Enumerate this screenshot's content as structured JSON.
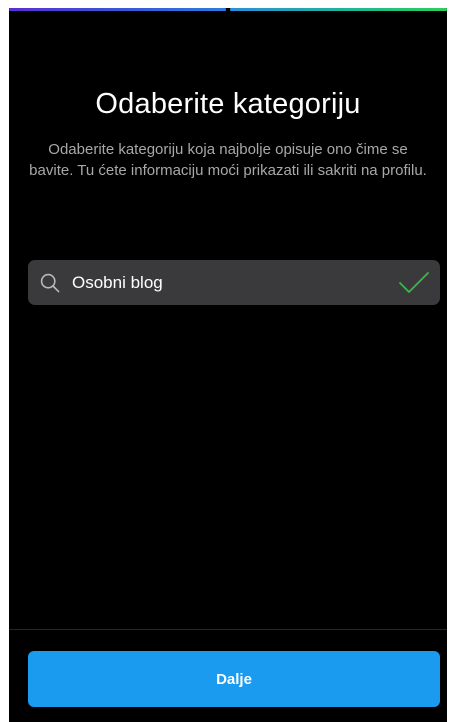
{
  "header": {
    "title": "Odaberite kategoriju",
    "subtitle": "Odaberite kategoriju koja najbolje opisuje ono čime se bavite. Tu ćete informaciju moći prikazati ili sakriti na profilu."
  },
  "progress": {
    "steps_total": 2,
    "colors": [
      "#3a56d6",
      "#1fb597"
    ]
  },
  "search": {
    "icon": "search-icon",
    "value": "Osobni blog",
    "selected_icon": "check-icon",
    "check_color": "#3bb54a"
  },
  "footer": {
    "next_label": "Dalje",
    "button_color": "#1a9bf0"
  }
}
